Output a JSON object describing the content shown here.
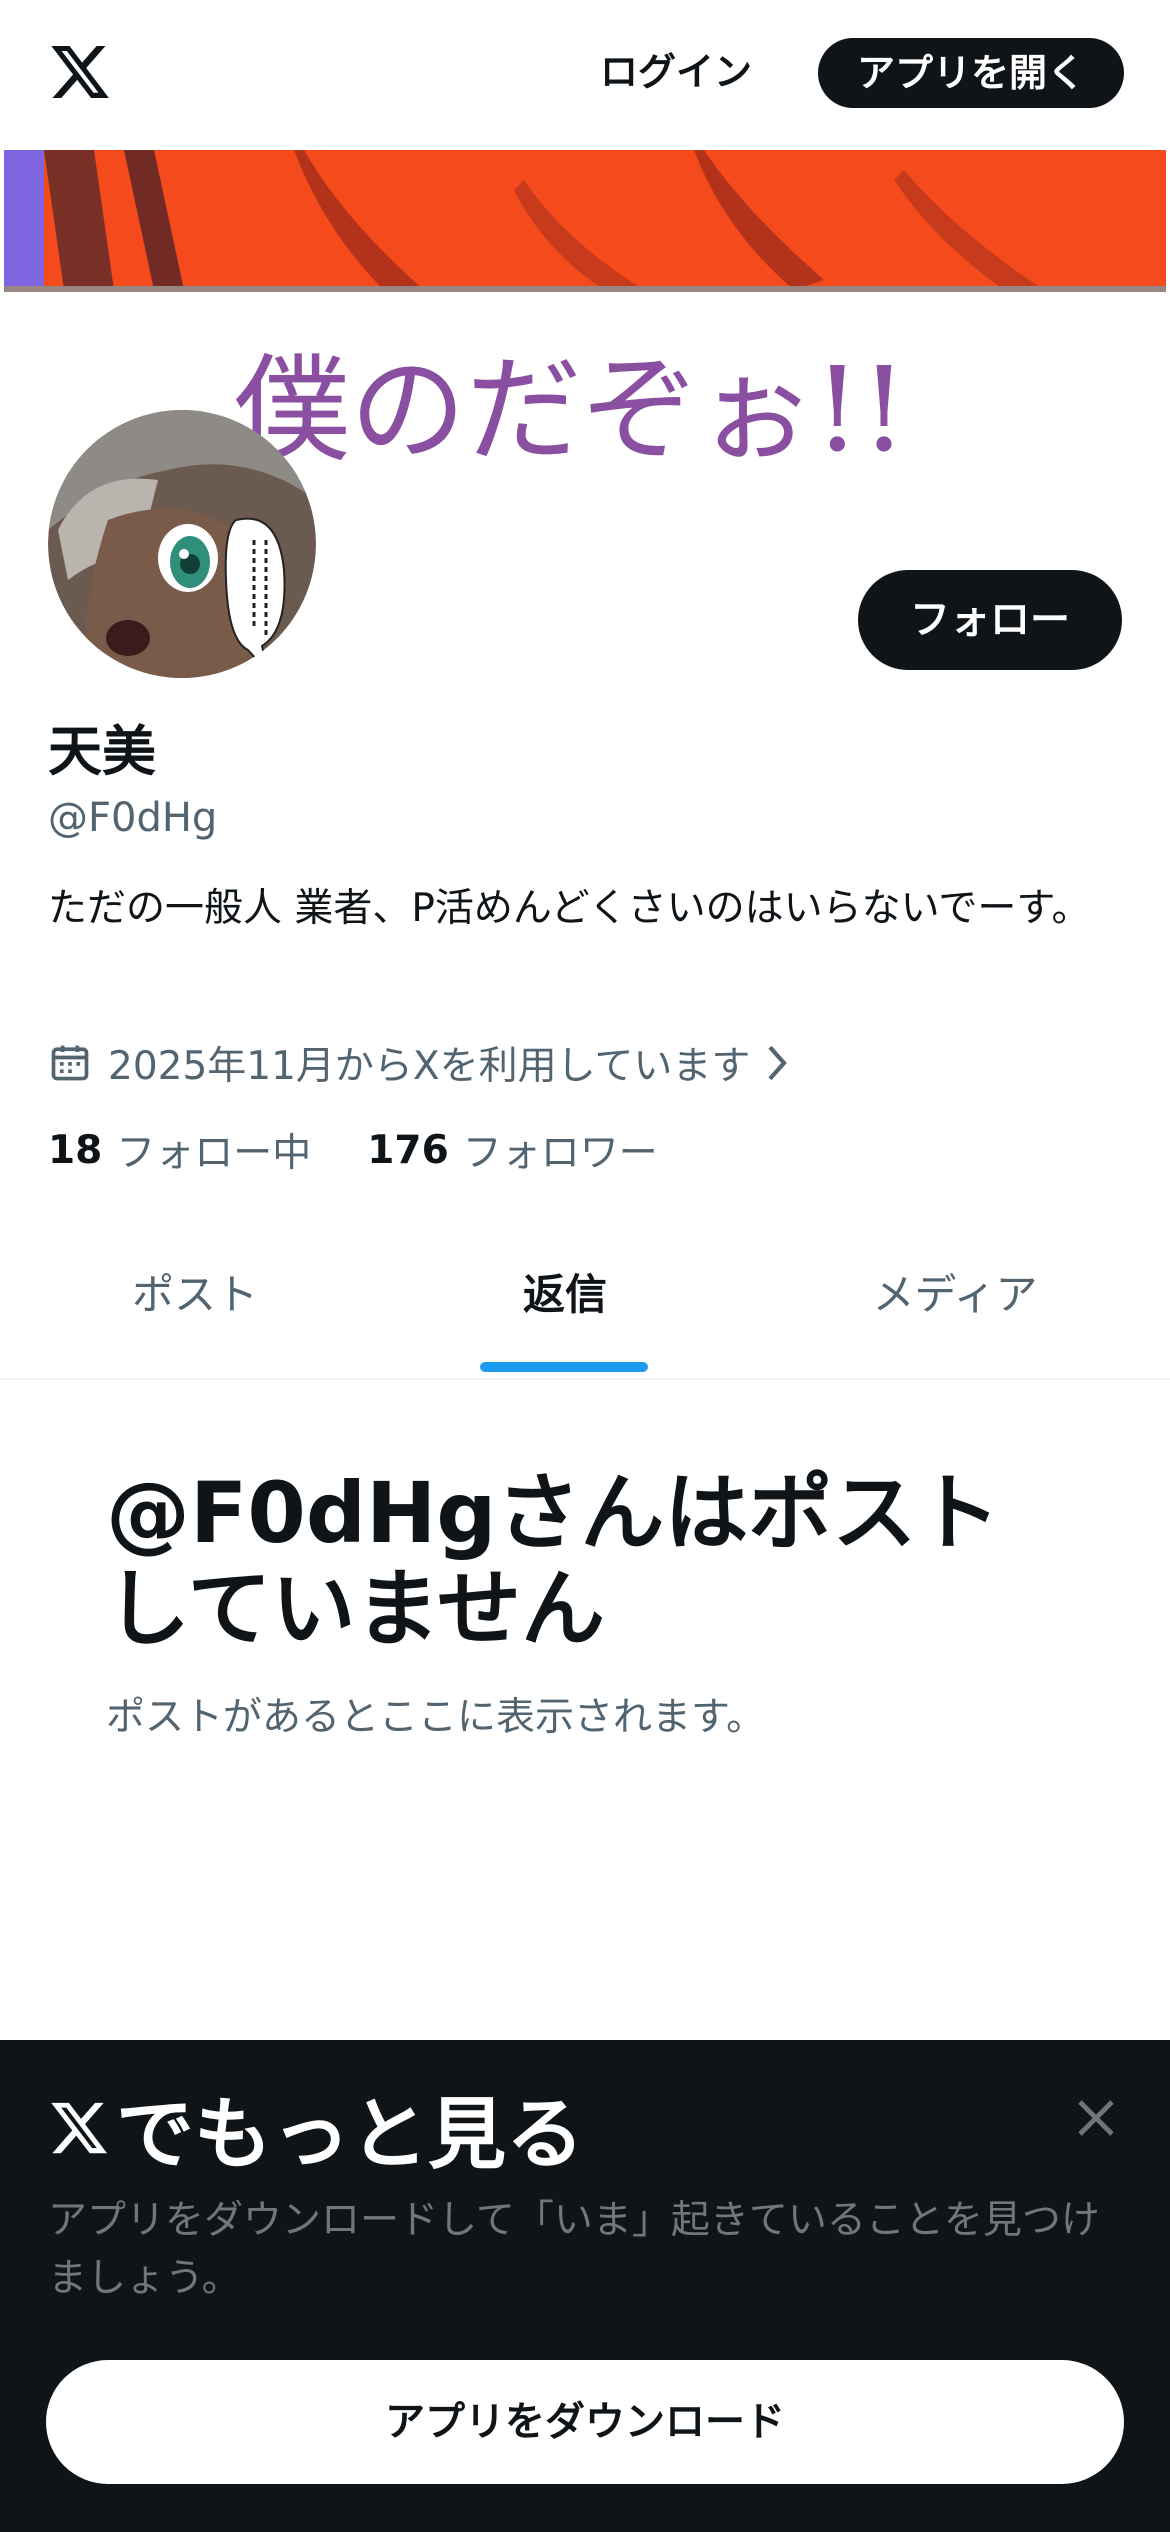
{
  "header": {
    "login_label": "ログイン",
    "open_app_label": "アプリを開く"
  },
  "banner": {
    "text": "僕のだぞぉ!!"
  },
  "profile": {
    "follow_label": "フォロー",
    "display_name": "天美",
    "handle": "@F0dHg",
    "bio": "ただの一般人 業者、P活めんどくさいのはいらないでーす。",
    "joined": "2025年11月からXを利用しています",
    "following_count": "18",
    "following_label": "フォロー中",
    "followers_count": "176",
    "followers_label": "フォロワー"
  },
  "tabs": [
    {
      "label": "ポスト",
      "active": false
    },
    {
      "label": "返信",
      "active": true
    },
    {
      "label": "メディア",
      "active": false
    }
  ],
  "empty_state": {
    "title": "@F0dHgさんはポストしていません",
    "subtitle": "ポストがあるとここに表示されます。"
  },
  "sheet": {
    "title": "でもっと見る",
    "text": "アプリをダウンロードして「いま」起きていることを見つけましょう。",
    "download_label": "アプリをダウンロード"
  },
  "colors": {
    "text_primary": "#0f1419",
    "text_secondary": "#536471",
    "accent": "#1d9bf0",
    "sheet_bg": "#0f1419",
    "sheet_text": "#71767b",
    "banner_orange": "#f44a1c",
    "banner_text": "#8a4fa0"
  },
  "icons": {
    "logo": "x-logo-icon",
    "calendar": "calendar-icon",
    "chevron": "chevron-right-icon",
    "close": "close-icon"
  }
}
